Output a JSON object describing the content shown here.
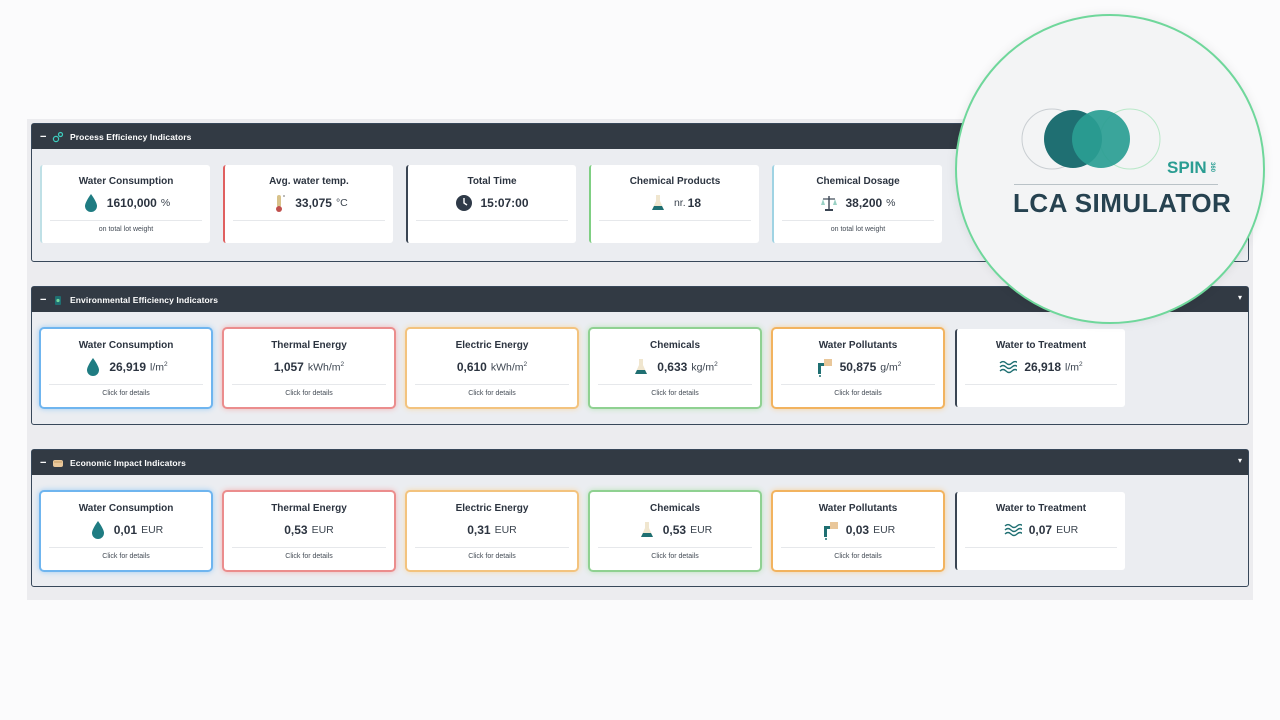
{
  "panels": [
    {
      "title": "Process Efficiency Indicators",
      "collapse": "−",
      "icon": "gears-icon",
      "cards": [
        {
          "title": "Water Consumption",
          "value": "1610,000",
          "unit": "%",
          "foot": "on total lot weight",
          "icon": "water-drop-icon",
          "accent": "#bfe0e6"
        },
        {
          "title": "Avg. water temp.",
          "value": "33,075",
          "unit": "°C",
          "foot": "",
          "icon": "thermometer-icon",
          "accent": "#e06060"
        },
        {
          "title": "Total Time",
          "value": "15:07:00",
          "unit": "",
          "foot": "",
          "icon": "clock-icon",
          "accent": "#3a4553"
        },
        {
          "title": "Chemical Products",
          "prefix": "nr.",
          "value": "18",
          "unit": "",
          "foot": "",
          "icon": "flask-icon",
          "accent": "#7fcf83"
        },
        {
          "title": "Chemical Dosage",
          "value": "38,200",
          "unit": "%",
          "foot": "on total lot weight",
          "icon": "scale-icon",
          "accent": "#9fd3e3"
        }
      ]
    },
    {
      "title": "Environmental Efficiency Indicators",
      "collapse": "−",
      "caret": "▾",
      "icon": "recycle-bin-icon",
      "cards": [
        {
          "title": "Water Consumption",
          "value": "26,919",
          "unit": "l/m",
          "sup": "2",
          "foot": "Click for details",
          "icon": "water-drop-icon"
        },
        {
          "title": "Thermal Energy",
          "value": "1,057",
          "unit": "kWh/m",
          "sup": "2",
          "foot": "Click for details",
          "icon": ""
        },
        {
          "title": "Electric Energy",
          "value": "0,610",
          "unit": "kWh/m",
          "sup": "2",
          "foot": "Click for details",
          "icon": ""
        },
        {
          "title": "Chemicals",
          "value": "0,633",
          "unit": "kg/m",
          "sup": "2",
          "foot": "Click for details",
          "icon": "flask-icon"
        },
        {
          "title": "Water Pollutants",
          "value": "50,875",
          "unit": "g/m",
          "sup": "2",
          "foot": "Click for details",
          "icon": "pipe-icon"
        },
        {
          "title": "Water to Treatment",
          "value": "26,918",
          "unit": "l/m",
          "sup": "2",
          "foot": "",
          "icon": "waves-icon"
        }
      ]
    },
    {
      "title": "Economic Impact Indicators",
      "collapse": "−",
      "caret": "▾",
      "icon": "money-icon",
      "cards": [
        {
          "title": "Water Consumption",
          "value": "0,01",
          "unit": "EUR",
          "foot": "Click for details",
          "icon": "water-drop-icon"
        },
        {
          "title": "Thermal Energy",
          "value": "0,53",
          "unit": "EUR",
          "foot": "Click for details",
          "icon": ""
        },
        {
          "title": "Electric Energy",
          "value": "0,31",
          "unit": "EUR",
          "foot": "Click for details",
          "icon": ""
        },
        {
          "title": "Chemicals",
          "value": "0,53",
          "unit": "EUR",
          "foot": "Click for details",
          "icon": "flask-icon"
        },
        {
          "title": "Water Pollutants",
          "value": "0,03",
          "unit": "EUR",
          "foot": "Click for details",
          "icon": "pipe-icon"
        },
        {
          "title": "Water to Treatment",
          "value": "0,07",
          "unit": "EUR",
          "foot": "",
          "icon": "waves-icon"
        }
      ]
    }
  ],
  "logo": {
    "brand": "SPIN",
    "version": "360",
    "product": "LCA SIMULATOR",
    "colors": {
      "teal_dark": "#1f6f72",
      "teal": "#2a9d92",
      "navy": "#264250"
    }
  }
}
